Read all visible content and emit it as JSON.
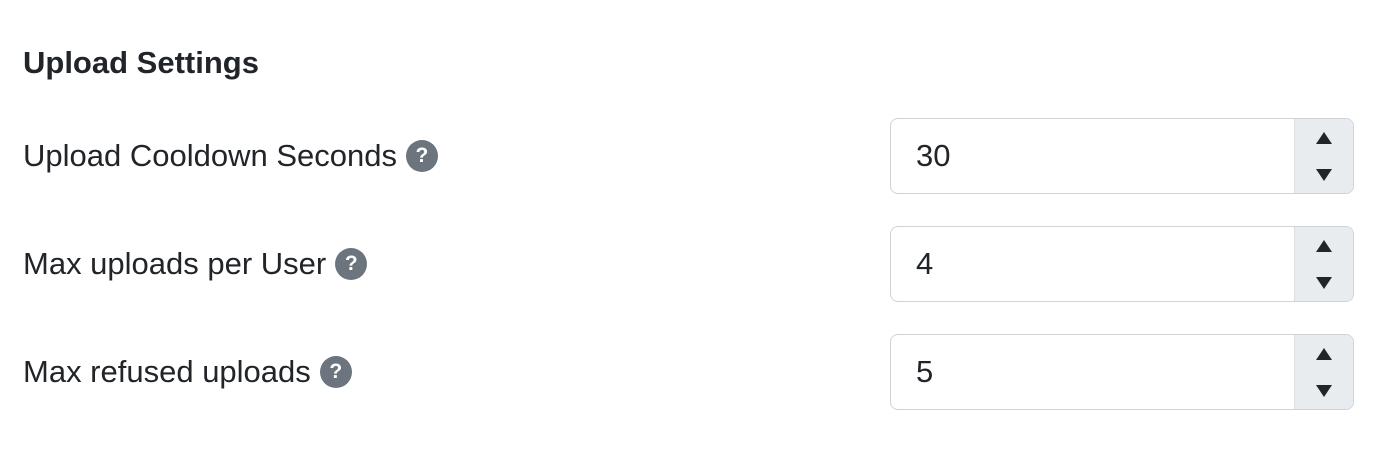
{
  "section": {
    "title": "Upload Settings"
  },
  "help_icon_glyph": "?",
  "settings": [
    {
      "label": "Upload Cooldown Seconds",
      "value": "30"
    },
    {
      "label": "Max uploads per User",
      "value": "4"
    },
    {
      "label": "Max refused uploads",
      "value": "5"
    }
  ],
  "icons": {
    "help": "question-circle-icon",
    "increment": "triangle-up-icon",
    "decrement": "triangle-down-icon"
  },
  "colors": {
    "text": "#212529",
    "help_icon_bg": "#6c757d",
    "input_border": "#ced4da",
    "spinner_bg": "#e9ecef"
  }
}
